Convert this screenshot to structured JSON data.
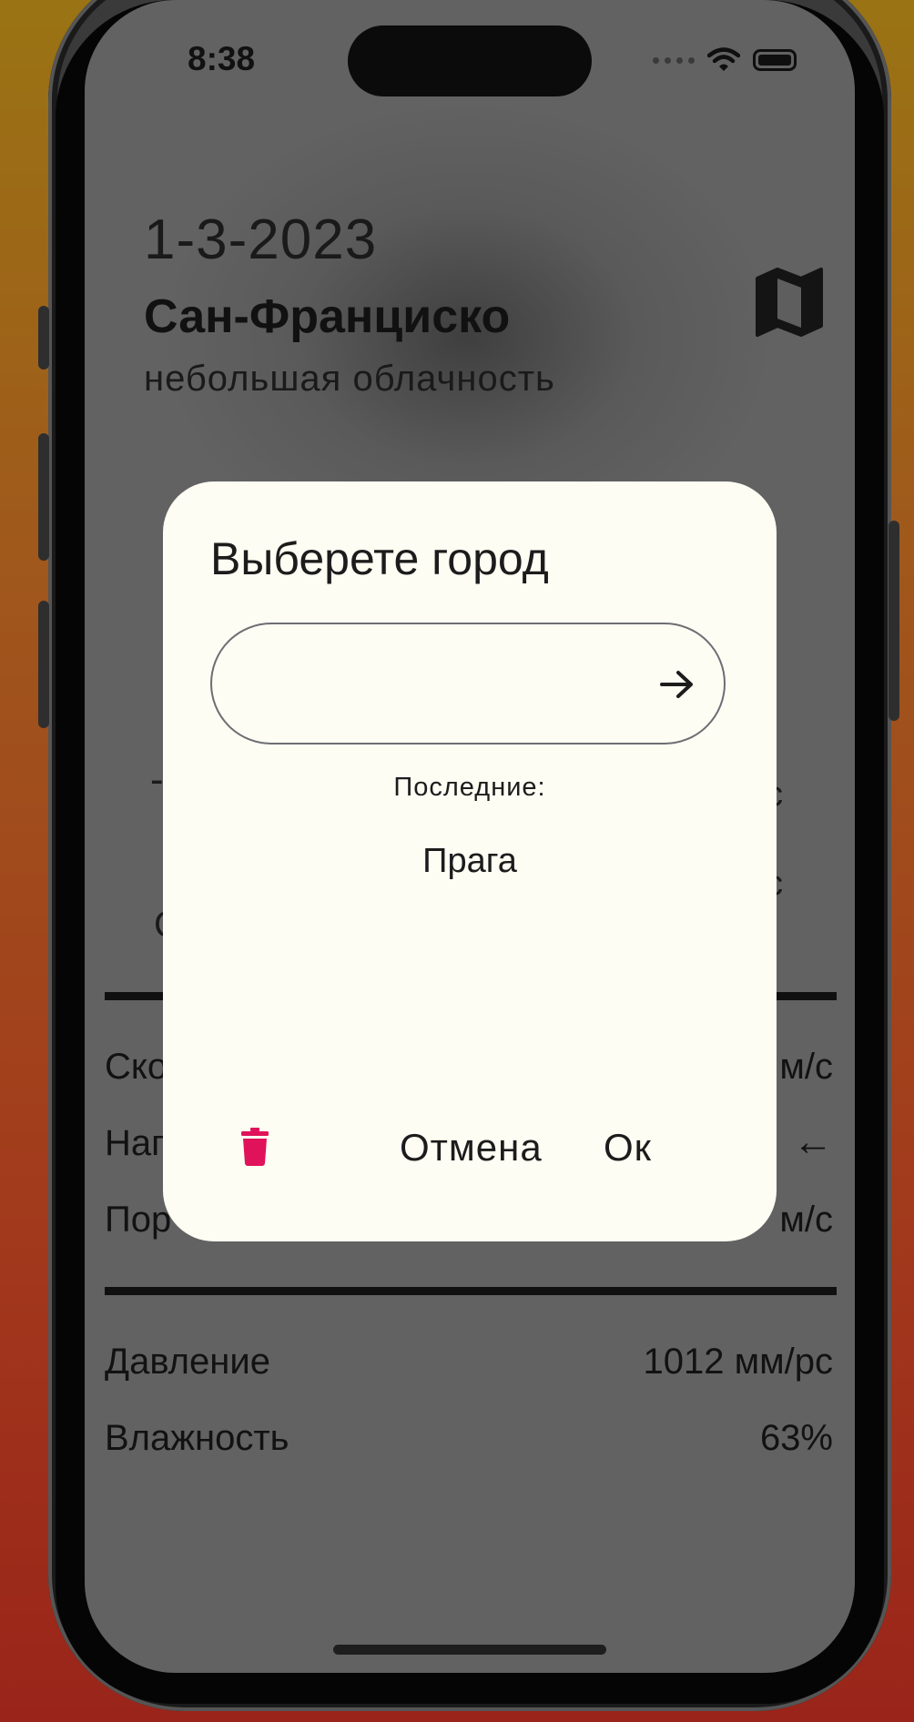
{
  "status_bar": {
    "time": "8:38"
  },
  "background": {
    "date": "1-3-2023",
    "city": "Сан-Франциско",
    "condition": "небольшая облачность",
    "partial_fragments": {
      "left_dash": "-",
      "left_char": "С",
      "right_ms_1": "с",
      "right_ms_2": "с"
    },
    "wind_rows": [
      {
        "label": "Ско",
        "value": "м/с"
      },
      {
        "label": "Нап",
        "value": "←"
      },
      {
        "label": "Пор",
        "value": "м/с"
      }
    ],
    "pressure": {
      "label": "Давление",
      "value": "1012 мм/рс"
    },
    "humidity": {
      "label": "Влажность",
      "value": "63%"
    }
  },
  "dialog": {
    "title": "Выберете город",
    "input": {
      "value": "",
      "placeholder": ""
    },
    "recent_label": "Последние:",
    "recent_items": [
      "Прага"
    ],
    "cancel_label": "Отмена",
    "ok_label": "Ок"
  },
  "colors": {
    "dialog_bg": "#fdfdf3",
    "trash": "#e0135a",
    "overlay": "#5f5f5f",
    "outer_bg_top": "#9a7414",
    "outer_bg_bottom": "#9a241a"
  }
}
